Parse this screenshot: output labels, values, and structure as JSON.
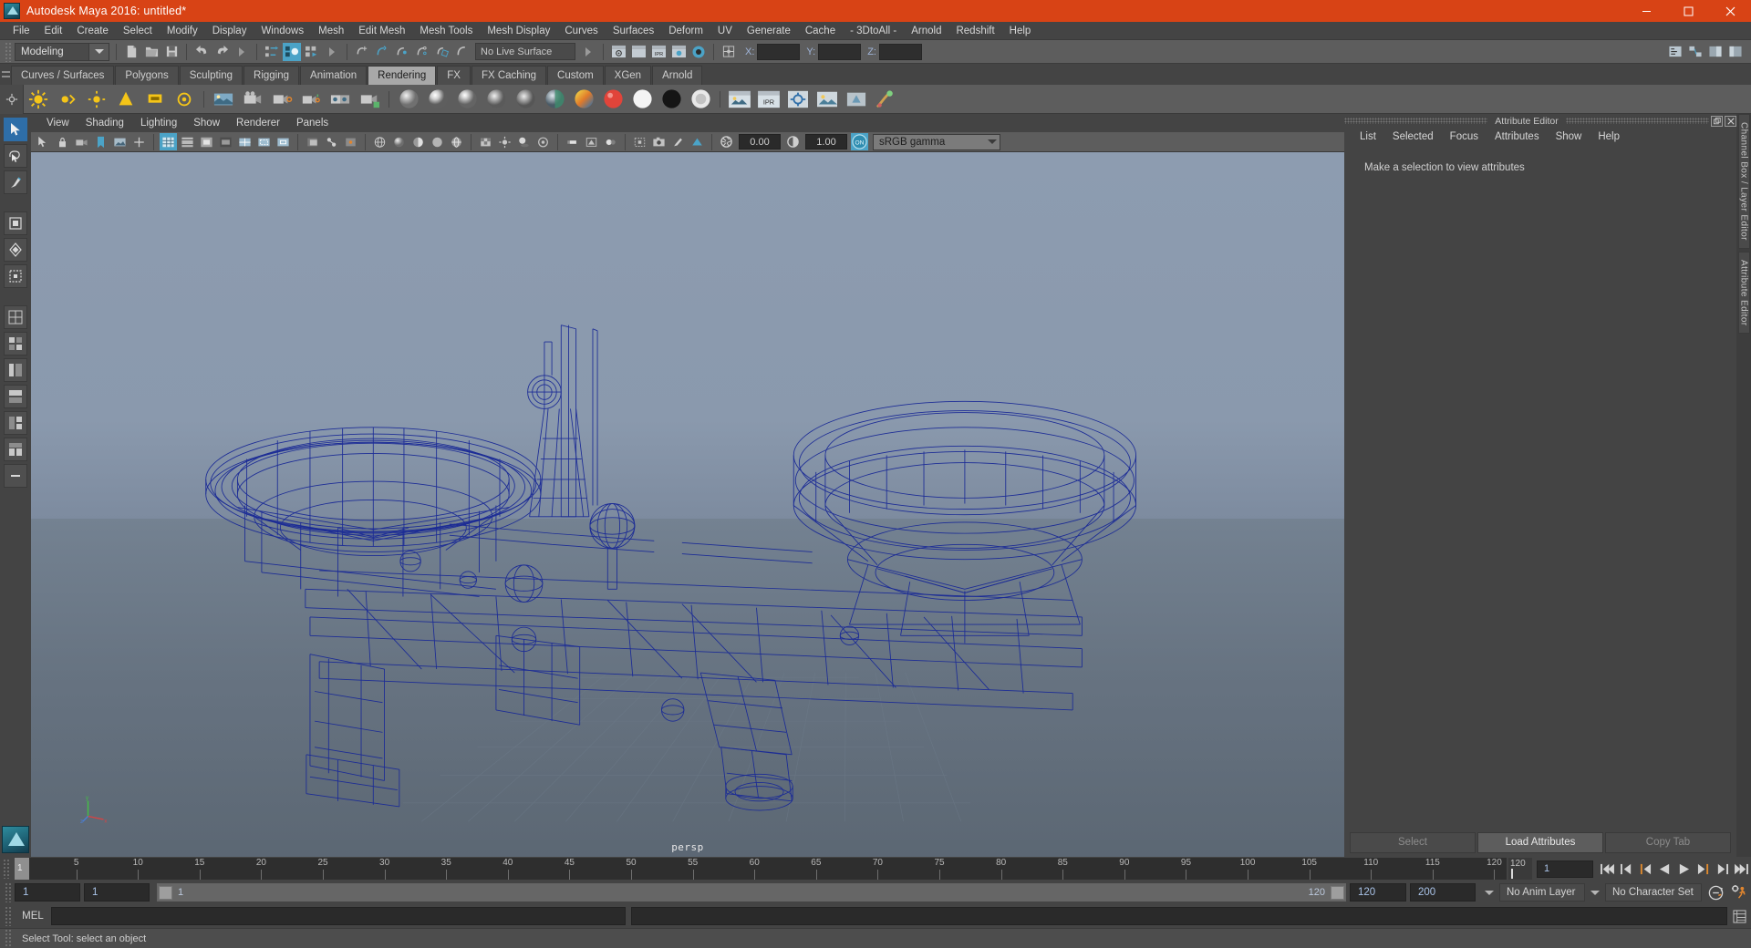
{
  "window": {
    "title": "Autodesk Maya 2016: untitled*",
    "app_icon": "maya-logo-icon",
    "controls": {
      "minimize": "–",
      "maximize": "❐",
      "close": "✕"
    },
    "titlebar_color": "#d84315"
  },
  "menubar": {
    "items": [
      "File",
      "Edit",
      "Create",
      "Select",
      "Modify",
      "Display",
      "Windows",
      "Mesh",
      "Edit Mesh",
      "Mesh Tools",
      "Mesh Display",
      "Curves",
      "Surfaces",
      "Deform",
      "UV",
      "Generate",
      "Cache",
      "- 3DtoAll -",
      "Arnold",
      "Redshift",
      "Help"
    ]
  },
  "statusline": {
    "menu_set": "Modeling",
    "live_surface": "No Live Surface",
    "coords": [
      {
        "label": "X:",
        "value": ""
      },
      {
        "label": "Y:",
        "value": ""
      },
      {
        "label": "Z:",
        "value": ""
      }
    ],
    "icons_file": [
      "new-scene-icon",
      "open-scene-icon",
      "save-scene-icon",
      "undo-icon",
      "redo-icon"
    ],
    "icons_select_mode": [
      "select-by-hierarchy-icon",
      "select-by-object-icon",
      "select-by-component-icon"
    ],
    "icons_snap": [
      "snap-to-grid-icon",
      "snap-to-curve-icon",
      "snap-to-point-icon",
      "snap-to-projected-center-icon",
      "snap-to-view-plane-icon",
      "make-live-icon"
    ],
    "icons_render": [
      "render-current-frame-icon",
      "render-sequence-icon",
      "ipr-render-icon",
      "render-settings-icon",
      "hypershade-icon"
    ],
    "icons_editors": [
      "show-manipulator-icon",
      "outliner-icon",
      "node-editor-icon",
      "attribute-editor-toggle-icon"
    ]
  },
  "shelf": {
    "tabs": [
      "Curves / Surfaces",
      "Polygons",
      "Sculpting",
      "Rigging",
      "Animation",
      "Rendering",
      "FX",
      "FX Caching",
      "Custom",
      "XGen",
      "Arnold"
    ],
    "active_tab": "Rendering",
    "icons": [
      "ambient-light-icon",
      "directional-light-icon",
      "point-light-icon",
      "spot-light-icon",
      "area-light-icon",
      "volume-light-icon",
      "image-plane-icon",
      "camera-icon",
      "camera-aim-icon",
      "lambert-material-icon",
      "blinn-material-icon",
      "phong-material-icon",
      "phong-e-material-icon",
      "anisotropic-material-icon",
      "layered-shader-icon",
      "ramp-shader-icon",
      "surface-shader-icon",
      "use-background-icon",
      "render-current-frame-icon",
      "ipr-render-icon",
      "render-settings-icon",
      "render-view-icon",
      "hardware-render-icon",
      "paint-effects-icon"
    ]
  },
  "toolbox": {
    "tools": [
      {
        "name": "select-tool",
        "active": true
      },
      {
        "name": "lasso-select-tool",
        "active": false
      },
      {
        "name": "paint-select-tool",
        "active": false
      },
      {
        "name": "move-tool",
        "active": false
      },
      {
        "name": "rotate-tool",
        "active": false
      },
      {
        "name": "scale-tool",
        "active": false
      },
      {
        "name": "last-tool-used",
        "active": false
      },
      {
        "name": "single-perspective-layout",
        "active": false
      },
      {
        "name": "four-view-layout",
        "active": false
      },
      {
        "name": "persp-outliner-layout",
        "active": false
      },
      {
        "name": "persp-graph-layout",
        "active": false
      },
      {
        "name": "hypershade-persp-layout",
        "active": false
      },
      {
        "name": "persp-render-layout",
        "active": false
      },
      {
        "name": "more-layouts",
        "active": false
      }
    ]
  },
  "viewport": {
    "menus": [
      "View",
      "Shading",
      "Lighting",
      "Show",
      "Renderer",
      "Panels"
    ],
    "camera_label": "persp",
    "gamma": {
      "exposure": "0.00",
      "contrast": "1.00",
      "view_transform": "sRGB gamma",
      "toggle_state": "ON"
    },
    "toolbar_icons": [
      "select-camera-icon",
      "lock-camera-icon",
      "camera-attributes-icon",
      "bookmarks-icon",
      "image-plane-icon",
      "two-d-pan-zoom-icon",
      "grid-toggle-icon",
      "film-gate-icon",
      "resolution-gate-icon",
      "gate-mask-icon",
      "field-chart-icon",
      "safe-action-icon",
      "safe-title-icon",
      "xray-toggle-icon",
      "xray-joints-icon",
      "xray-active-components-icon",
      "wireframe-shading-icon",
      "smooth-shade-all-icon",
      "smooth-shade-selected-icon",
      "flat-shade-icon",
      "shaded-wireframe-icon",
      "textured-icon",
      "use-lights-icon",
      "shadows-icon",
      "ao-icon",
      "motion-blur-icon",
      "multisample-icon",
      "depth-of-field-icon",
      "isolate-select-icon",
      "snapshot-icon",
      "grease-pencil-icon",
      "viewport-renderer-icon",
      "exposure-icon",
      "contrast-icon",
      "color-management-icon"
    ],
    "background_colors": {
      "sky_top": "#8d9cb0",
      "sky_bottom": "#5f6d81",
      "wireframe": "#1a2a96"
    },
    "model": "ferris-wheel-mechanism-wireframe"
  },
  "attribute_editor": {
    "panel_title": "Attribute Editor",
    "window_buttons": [
      "undock-icon",
      "close-icon"
    ],
    "menus": [
      "List",
      "Selected",
      "Focus",
      "Attributes",
      "Show",
      "Help"
    ],
    "empty_message": "Make a selection to view attributes",
    "footer_buttons": [
      {
        "label": "Select",
        "enabled": false
      },
      {
        "label": "Load Attributes",
        "enabled": true
      },
      {
        "label": "Copy Tab",
        "enabled": false
      }
    ],
    "side_tabs": [
      "Channel Box / Layer Editor",
      "Attribute Editor"
    ]
  },
  "timeline": {
    "current_frame": "1",
    "ticks": [
      "5",
      "10",
      "15",
      "20",
      "25",
      "30",
      "35",
      "40",
      "45",
      "50",
      "55",
      "60",
      "65",
      "70",
      "75",
      "80",
      "85",
      "90",
      "95",
      "100",
      "105",
      "110",
      "115",
      "120"
    ],
    "end_label": "120",
    "frame_field": "1",
    "playback_icons": [
      "go-to-start-icon",
      "step-back-keyframe-icon",
      "step-back-frame-icon",
      "play-backwards-icon",
      "play-forwards-icon",
      "step-forward-frame-icon",
      "step-forward-keyframe-icon",
      "go-to-end-icon"
    ]
  },
  "range_slider": {
    "anim_start": "1",
    "anim_end_field": "1",
    "range_start_label": "1",
    "range_end_label": "120",
    "playback_end": "120",
    "anim_end": "200",
    "anim_layer": "No Anim Layer",
    "character_set": "No Character Set",
    "icons": [
      "auto-keyframe-icon",
      "animation-preferences-icon"
    ]
  },
  "command_line": {
    "label": "MEL",
    "input_value": "",
    "output_value": "",
    "icon": "script-editor-icon"
  },
  "help_line": {
    "text": "Select Tool: select an object"
  }
}
